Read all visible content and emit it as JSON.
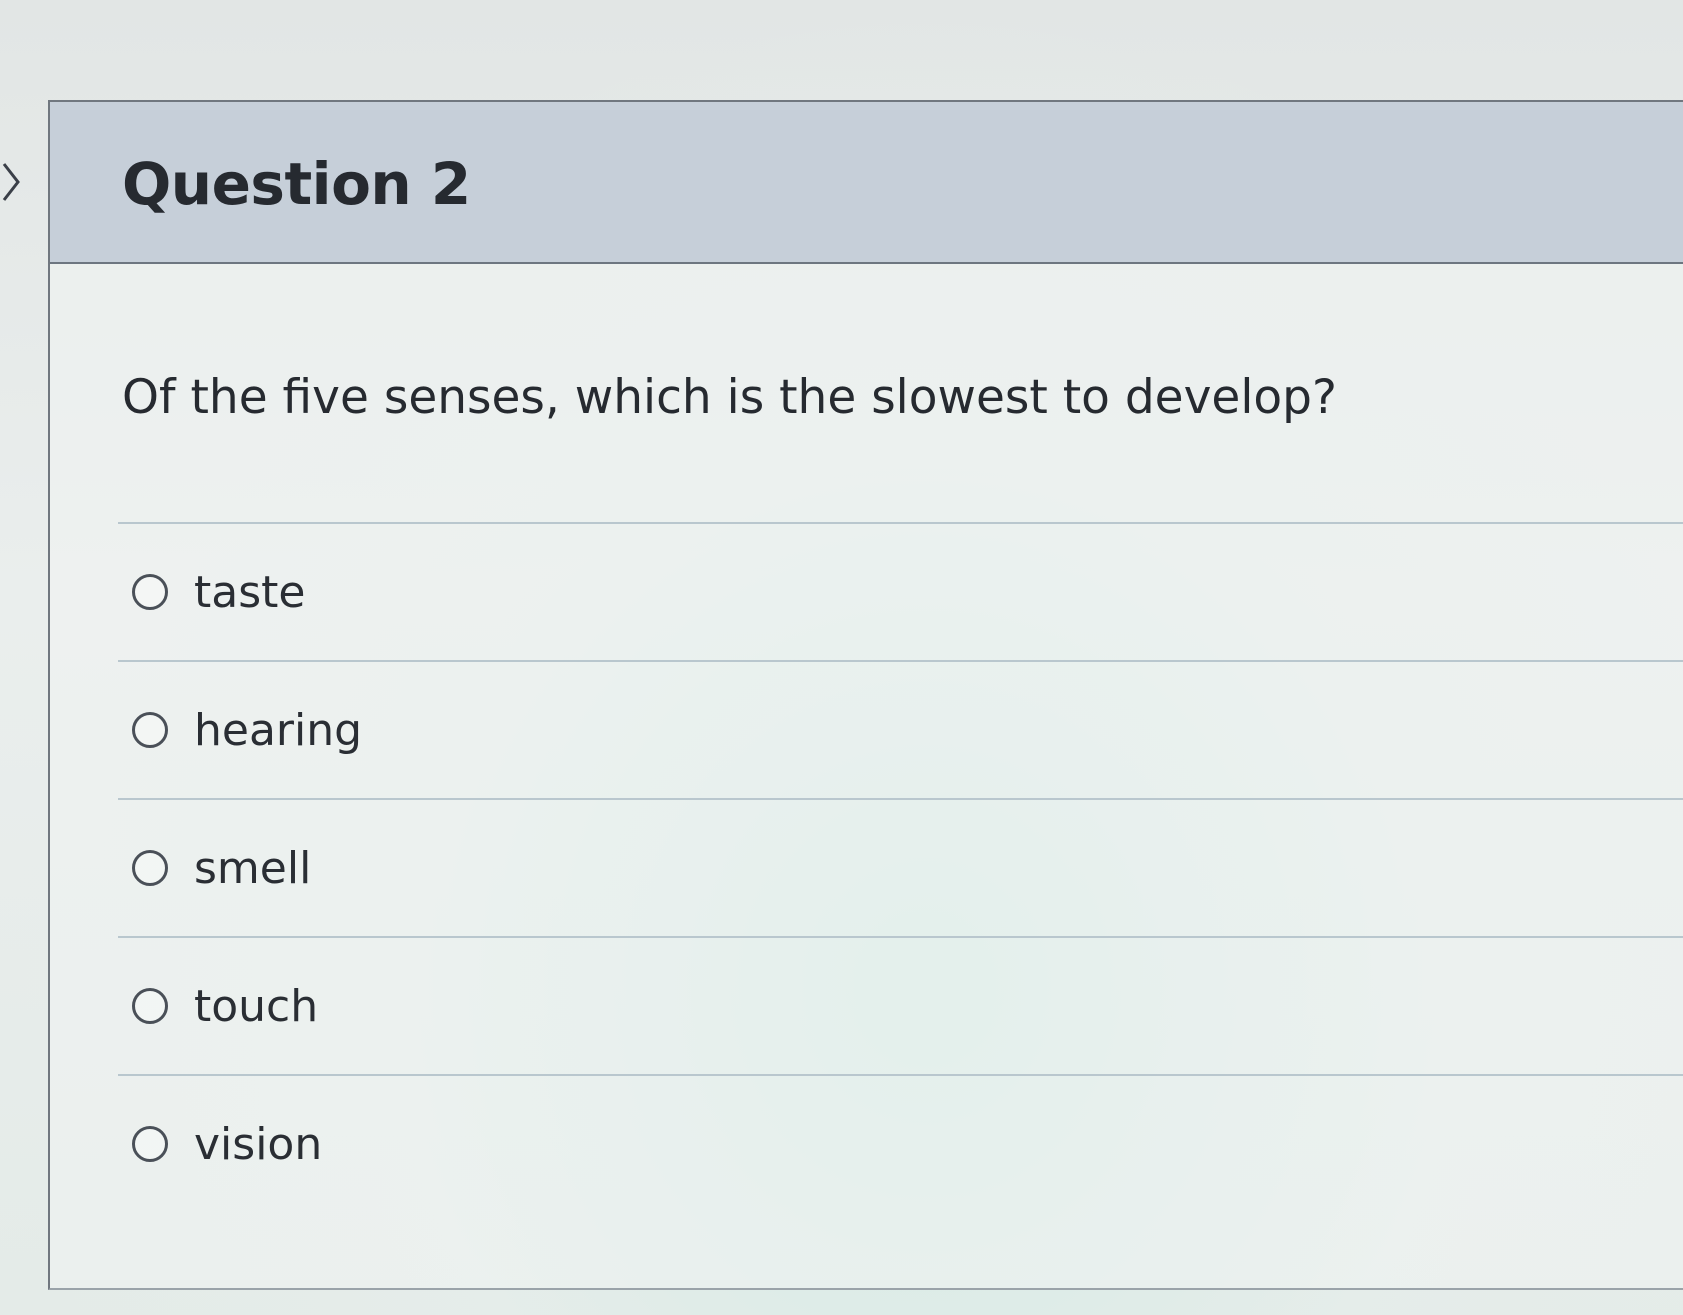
{
  "question": {
    "title": "Question 2",
    "text": "Of the five senses, which is the slowest to develop?",
    "answers": [
      {
        "label": "taste"
      },
      {
        "label": "hearing"
      },
      {
        "label": "smell"
      },
      {
        "label": "touch"
      },
      {
        "label": "vision"
      }
    ]
  },
  "icons": {
    "collapse": "chevron-right-icon",
    "radio": "radio-unselected-icon"
  },
  "colors": {
    "header_bg": "#c6cfd9",
    "divider": "#b9c7ce",
    "text": "#262a30"
  }
}
